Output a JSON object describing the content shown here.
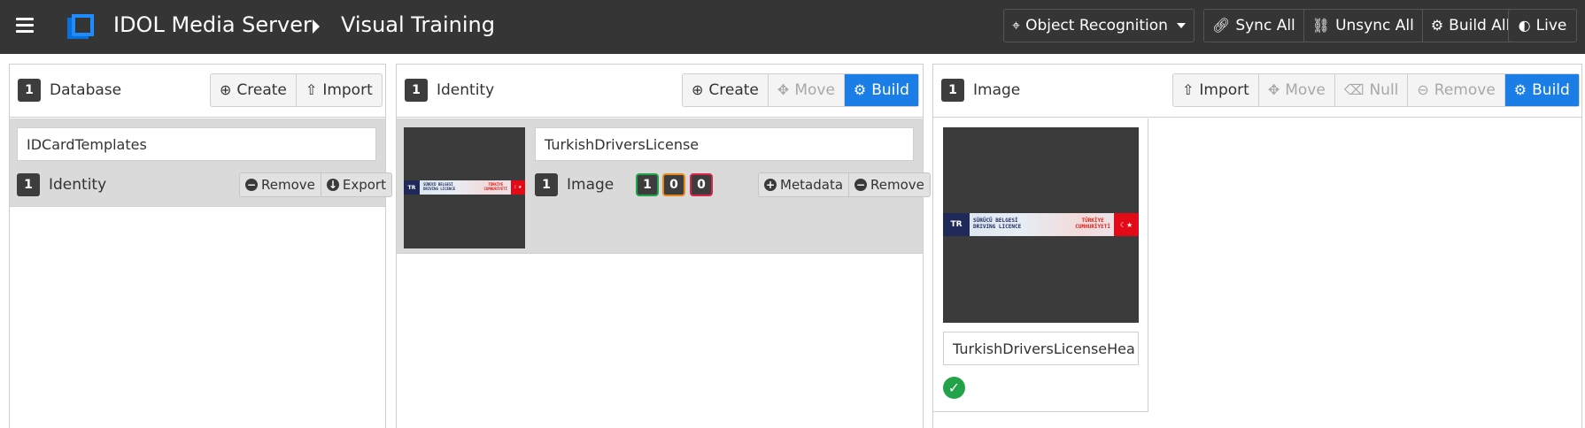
{
  "header": {
    "app_title": "IDOL Media Server",
    "page_title": "Visual Training",
    "mode_dropdown": "Object Recognition",
    "sync_all": "Sync All",
    "unsync_all": "Unsync All",
    "build_all": "Build All",
    "live": "Live"
  },
  "database_panel": {
    "count": "1",
    "title": "Database",
    "create": "Create",
    "import": "Import",
    "item": {
      "name": "IDCardTemplates",
      "identity_count": "1",
      "identity_label": "Identity",
      "remove": "Remove",
      "export": "Export"
    }
  },
  "identity_panel": {
    "count": "1",
    "title": "Identity",
    "create": "Create",
    "move": "Move",
    "build": "Build",
    "item": {
      "name": "TurkishDriversLicense",
      "image_count": "1",
      "image_label": "Image",
      "status_trained": "1",
      "status_pending": "0",
      "status_failed": "0",
      "metadata": "Metadata",
      "remove": "Remove"
    }
  },
  "image_panel": {
    "count": "1",
    "title": "Image",
    "import": "Import",
    "move": "Move",
    "null": "Null",
    "remove": "Remove",
    "build": "Build",
    "item": {
      "name": "TurkishDriversLicenseHea",
      "status": "trained"
    }
  },
  "license_strip": {
    "country_code": "TR",
    "left_line1": "SÜRÜCÜ BELGESİ",
    "left_line2": "DRIVING LICENCE",
    "right_line1": "TÜRKİYE",
    "right_line2": "CUMHURİYETİ",
    "flag_symbol": "☾★"
  },
  "colors": {
    "topbar": "#353535",
    "primary": "#1a7ee6",
    "trained": "#22a34a",
    "pending": "#e8871e",
    "failed": "#d6244b"
  }
}
